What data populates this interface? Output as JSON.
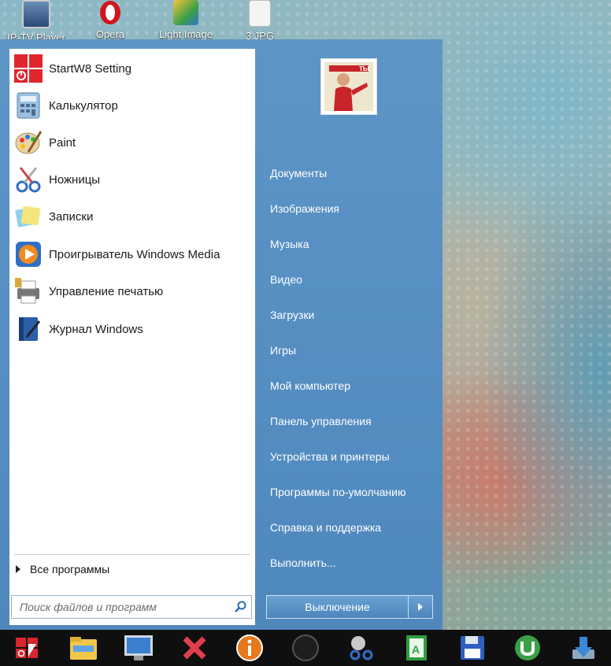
{
  "desktop_icons": [
    {
      "label": "IP-TV Player",
      "icon": "monitor-icon"
    },
    {
      "label": "Opera",
      "icon": "opera-icon"
    },
    {
      "label": "Light Image",
      "icon": "image-tool-icon"
    },
    {
      "label": "3.JPG",
      "icon": "image-file-icon"
    }
  ],
  "start_menu": {
    "programs": [
      {
        "label": "StartW8 Setting",
        "icon": "startw8-icon"
      },
      {
        "label": "Калькулятор",
        "icon": "calculator-icon"
      },
      {
        "label": "Paint",
        "icon": "paint-palette-icon"
      },
      {
        "label": "Ножницы",
        "icon": "scissors-icon"
      },
      {
        "label": "Записки",
        "icon": "sticky-notes-icon"
      },
      {
        "label": "Проигрыватель Windows Media",
        "icon": "media-player-icon"
      },
      {
        "label": "Управление печатью",
        "icon": "printer-icon"
      },
      {
        "label": "Журнал Windows",
        "icon": "journal-icon"
      }
    ],
    "all_programs": "Все программы",
    "search_placeholder": "Поиск файлов и программ",
    "right_links": [
      "Документы",
      "Изображения",
      "Музыка",
      "Видео",
      "Загрузки",
      "Игры",
      "Мой компьютер",
      "Панель управления",
      "Устройства и принтеры",
      "Программы по-умолчанию",
      "Справка и поддержка",
      "Выполнить..."
    ],
    "avatar_text": "ТЫ",
    "shutdown_label": "Выключение"
  },
  "taskbar": [
    {
      "icon": "start-button-icon",
      "color": "#d8262b"
    },
    {
      "icon": "folder-icon",
      "color": "#f2c64a"
    },
    {
      "icon": "monitor-icon",
      "color": "#3b7fd1"
    },
    {
      "icon": "close-x-icon",
      "color": "#e0404a"
    },
    {
      "icon": "info-icon",
      "color": "#e7781c"
    },
    {
      "icon": "circle-app-icon",
      "color": "#2a2a2a"
    },
    {
      "icon": "scissors-icon",
      "color": "#c9c9c9"
    },
    {
      "icon": "notepad-icon",
      "color": "#2f9e3f"
    },
    {
      "icon": "floppy-disk-icon",
      "color": "#2e5fbf"
    },
    {
      "icon": "utorrent-icon",
      "color": "#3aa047"
    },
    {
      "icon": "download-icon",
      "color": "#3b88d8"
    }
  ],
  "colors": {
    "menu_blue": "#5d95c7",
    "taskbar": "#0f0f10",
    "start_red": "#d8262b"
  }
}
